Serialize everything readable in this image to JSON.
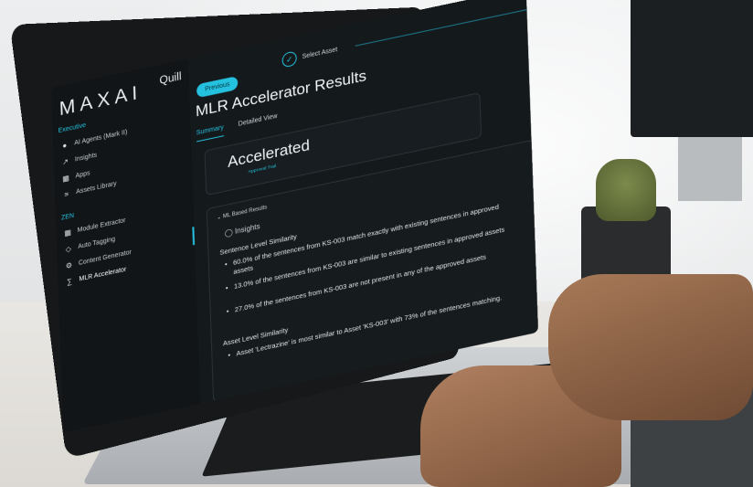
{
  "app": {
    "logo": "MAXAI",
    "name": "Quill"
  },
  "sidebar": {
    "section_1": "Executive",
    "section_2": "ZEN",
    "items": [
      {
        "label": "AI Agents (Mark II)",
        "icon": "robot-icon"
      },
      {
        "label": "Insights",
        "icon": "trend-icon"
      },
      {
        "label": "Apps",
        "icon": "apps-grid-icon"
      },
      {
        "label": "Assets Library",
        "icon": "library-icon"
      },
      {
        "label": "Module Extractor",
        "icon": "grid-icon"
      },
      {
        "label": "Auto Tagging",
        "icon": "tag-icon"
      },
      {
        "label": "Content Generator",
        "icon": "gear-icon"
      },
      {
        "label": "MLR Accelerator",
        "icon": "accelerator-icon"
      }
    ]
  },
  "header": {
    "previous_label": "Previous",
    "step_label": "Select Asset",
    "title": "MLR Accelerator Results",
    "tabs": [
      "Summary",
      "Detailed View"
    ]
  },
  "summary_card": {
    "title": "Accelerated",
    "subtitle": "Approval Trail"
  },
  "results": {
    "section_title": "ML Based Results",
    "insights_label": "Insights",
    "sentence_title": "Sentence Level Similarity",
    "sentence_bullets": [
      "60.0% of the sentences from KS-003 match exactly with existing sentences in approved assets",
      "13.0% of the sentences from KS-003 are similar to existing sentences in approved assets",
      "27.0% of the sentences from KS-003 are not present in any of the approved assets"
    ],
    "asset_title": "Asset Level Similarity",
    "asset_bullets": [
      "Asset 'Lectrazine' is most similar to Asset 'KS-003' with 73% of the sentences matching."
    ]
  },
  "colors": {
    "accent": "#25c2e0",
    "screen_bg": "#14191c"
  }
}
